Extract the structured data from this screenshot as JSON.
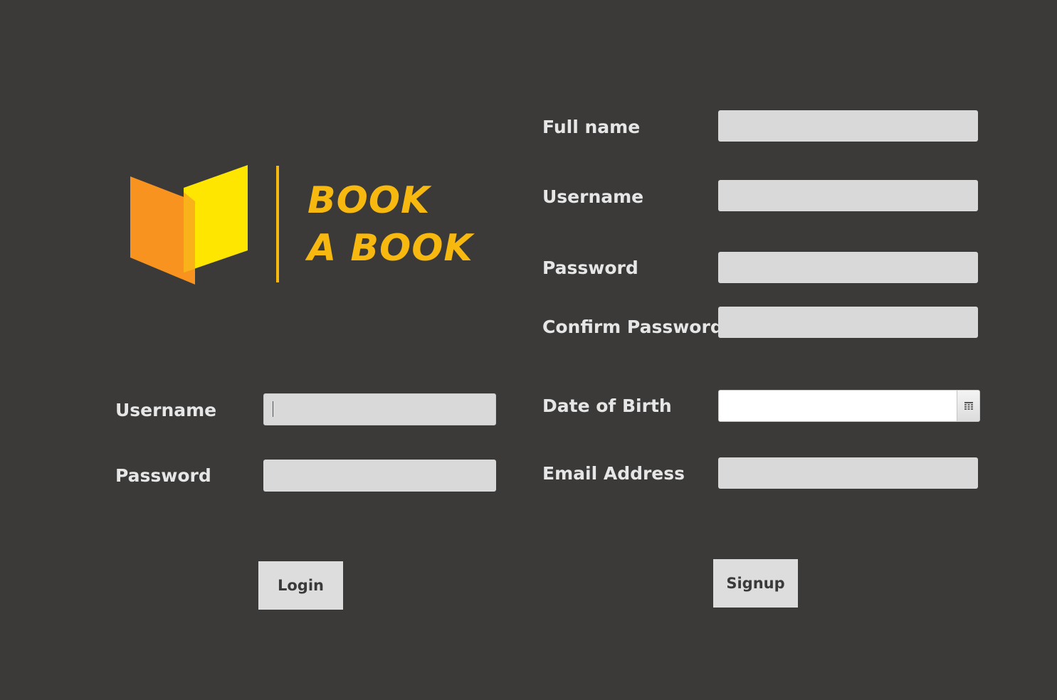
{
  "brand": {
    "line1": "BOOK",
    "line2": "A BOOK",
    "colors": {
      "orange": "#f7931e",
      "yellow": "#ffe600",
      "text": "#f7b80f"
    }
  },
  "login": {
    "username_label": "Username",
    "username_value": "",
    "password_label": "Password",
    "password_value": "",
    "button_label": "Login"
  },
  "signup": {
    "fullname_label": "Full name",
    "fullname_value": "",
    "username_label": "Username",
    "username_value": "",
    "password_label": "Password",
    "password_value": "",
    "confirm_label": "Confirm Password",
    "confirm_value": "",
    "dob_label": "Date of Birth",
    "dob_value": "",
    "dob_icon": "calendar-icon",
    "email_label": "Email Address",
    "email_value": "",
    "button_label": "Signup"
  },
  "colors": {
    "background": "#3b3a39",
    "label": "#e6e6e6",
    "field": "#d9d9d9",
    "button": "#dddddd"
  }
}
